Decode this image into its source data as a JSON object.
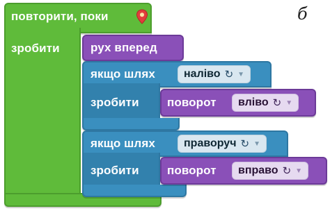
{
  "corner_letter": "б",
  "loop": {
    "label": "повторити, поки",
    "do_label": "зробити",
    "pin_icon": "location-pin-icon"
  },
  "move_forward": {
    "label": "рух вперед"
  },
  "if_left": {
    "label": "якщо шлях",
    "value": "наліво",
    "do_label": "зробити",
    "turn": {
      "label": "поворот",
      "value": "вліво"
    }
  },
  "if_right": {
    "label": "якщо шлях",
    "value": "праворуч",
    "do_label": "зробити",
    "turn": {
      "label": "поворот",
      "value": "вправо"
    }
  },
  "colors": {
    "loop": "#5fbb3a",
    "logic": "#3a8fbf",
    "action": "#8a50b8"
  }
}
